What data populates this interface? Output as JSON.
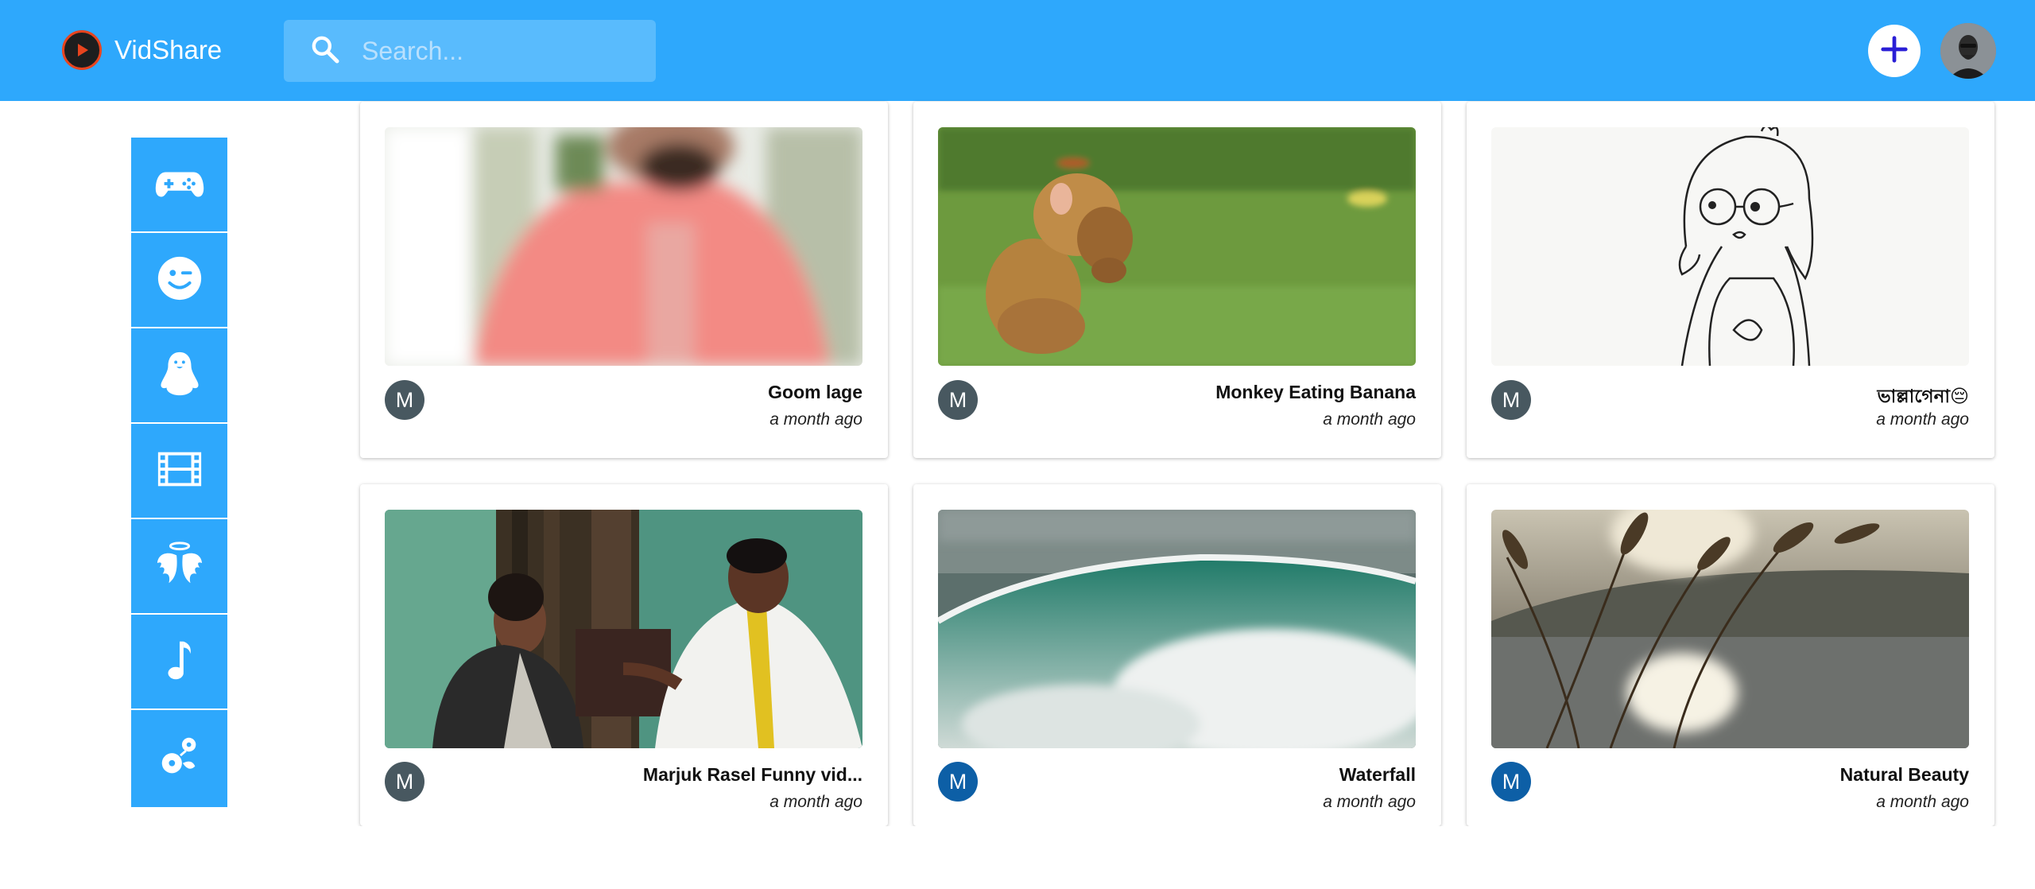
{
  "app": {
    "name": "VidShare"
  },
  "header": {
    "search_placeholder": "Search...",
    "search_value": ""
  },
  "colors": {
    "primary": "#2ea8fc",
    "avatar_grey": "#485860",
    "avatar_blue": "#0d5fa6"
  },
  "sidebar": {
    "items": [
      {
        "icon": "gamepad-icon"
      },
      {
        "icon": "smiley-wink-icon"
      },
      {
        "icon": "penguin-icon"
      },
      {
        "icon": "film-icon"
      },
      {
        "icon": "angel-wings-icon"
      },
      {
        "icon": "music-note-icon"
      },
      {
        "icon": "flowers-icon"
      }
    ]
  },
  "videos": [
    {
      "title": "Goom lage",
      "time": "a month ago",
      "avatar": "M",
      "avatar_color": "#485860"
    },
    {
      "title": "Monkey Eating Banana",
      "time": "a month ago",
      "avatar": "M",
      "avatar_color": "#485860"
    },
    {
      "title": "ভাল্লাগেনা😔",
      "time": "a month ago",
      "avatar": "M",
      "avatar_color": "#485860"
    },
    {
      "title": "Marjuk Rasel Funny vid...",
      "time": "a month ago",
      "avatar": "M",
      "avatar_color": "#485860"
    },
    {
      "title": "Waterfall",
      "time": "a month ago",
      "avatar": "M",
      "avatar_color": "#0d5fa6"
    },
    {
      "title": "Natural Beauty",
      "time": "a month ago",
      "avatar": "M",
      "avatar_color": "#0d5fa6"
    }
  ]
}
